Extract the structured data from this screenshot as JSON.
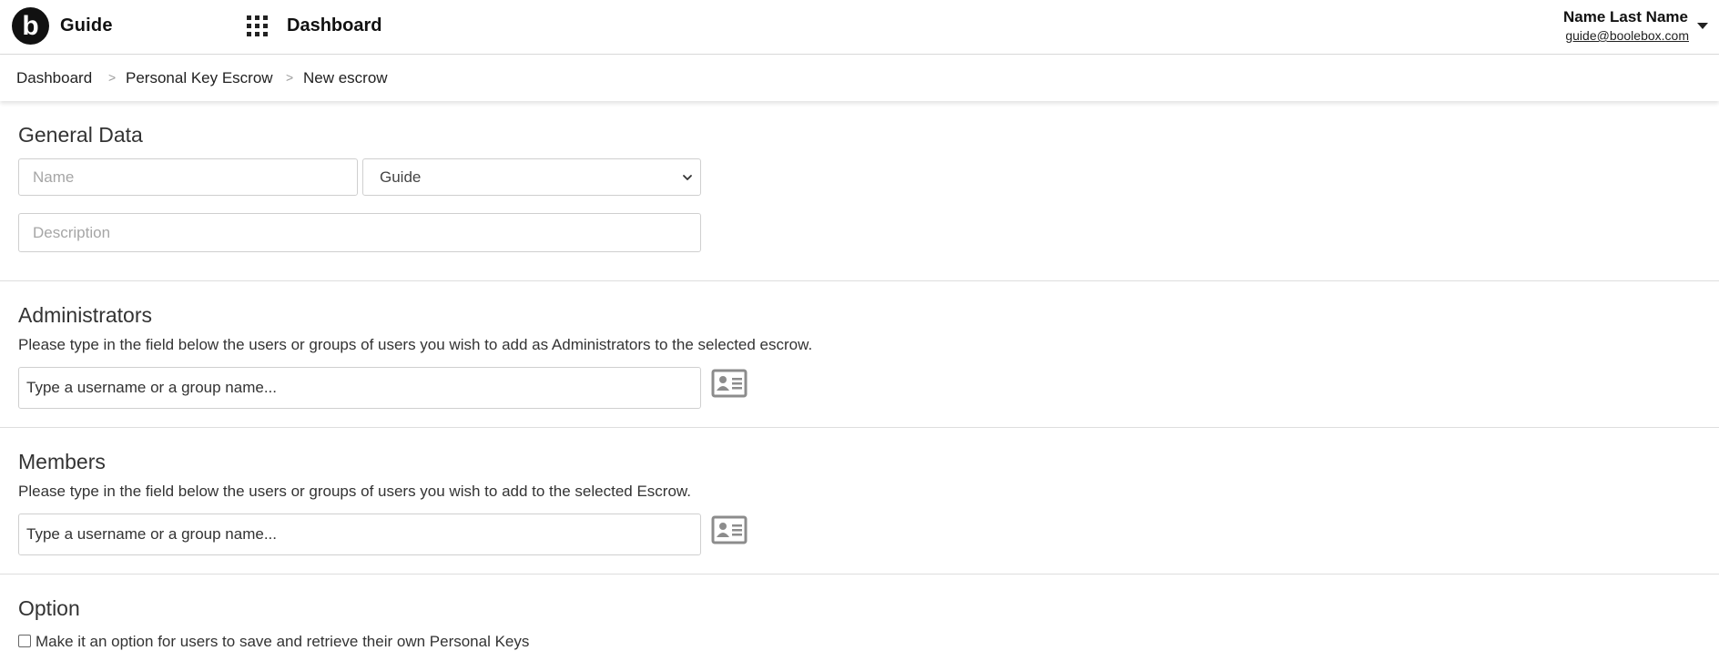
{
  "header": {
    "app_name": "Guide",
    "section_title": "Dashboard",
    "user_name": "Name Last Name",
    "user_email": "guide@boolebox.com",
    "logo_letter": "b"
  },
  "breadcrumb": {
    "items": [
      "Dashboard",
      "Personal Key Escrow",
      "New escrow"
    ],
    "separator": ">"
  },
  "general": {
    "title": "General Data",
    "name_placeholder": "Name",
    "select_value": "Guide",
    "description_placeholder": "Description"
  },
  "administrators": {
    "title": "Administrators",
    "description": "Please type in the field below the users or groups of users you wish to add as Administrators to the selected escrow.",
    "input_placeholder": "Type a username or a group name..."
  },
  "members": {
    "title": "Members",
    "description": "Please type in the field below the users or groups of users you wish to add to the selected Escrow.",
    "input_placeholder": "Type a username or a group name..."
  },
  "option": {
    "title": "Option",
    "checkbox_label": "Make it an option for users to save and retrieve their own Personal Keys",
    "checked": false
  },
  "icons": {
    "logo": "boolebox-logo-icon",
    "apps": "apps-grid-icon",
    "user_menu": "caret-down-icon",
    "select_chevron": "chevron-down-icon",
    "address_book": "contact-card-icon"
  },
  "colors": {
    "text": "#222222",
    "border": "#cfcfcf",
    "divider": "#dedede",
    "icon_gray": "#8c8c8c"
  }
}
